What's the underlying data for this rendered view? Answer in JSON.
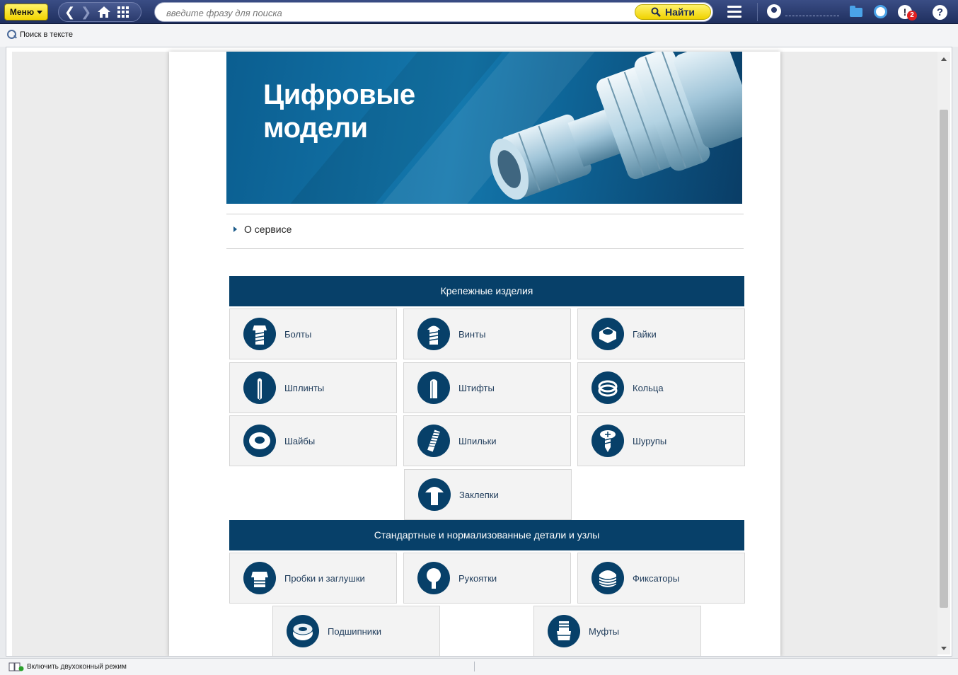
{
  "toolbar": {
    "menu_label": "Меню",
    "search_placeholder": "введите фразу для поиска",
    "find_label": "Найти",
    "notifications_count": "2",
    "help_label": "?",
    "alert_label": "!"
  },
  "subbar": {
    "search_in_text_label": "Поиск в тексте"
  },
  "banner": {
    "title_line1": "Цифровые",
    "title_line2": "модели"
  },
  "about": {
    "label": "О сервисе"
  },
  "sections": [
    {
      "title": "Крепежные изделия",
      "items": [
        {
          "label": "Болты",
          "icon": "bolt-icon"
        },
        {
          "label": "Винты",
          "icon": "screw-icon"
        },
        {
          "label": "Гайки",
          "icon": "nut-icon"
        },
        {
          "label": "Шплинты",
          "icon": "cotter-pin-icon"
        },
        {
          "label": "Штифты",
          "icon": "pin-icon"
        },
        {
          "label": "Кольца",
          "icon": "ring-icon"
        },
        {
          "label": "Шайбы",
          "icon": "washer-icon"
        },
        {
          "label": "Шпильки",
          "icon": "stud-icon"
        },
        {
          "label": "Шурупы",
          "icon": "wood-screw-icon"
        },
        {
          "label": "Заклепки",
          "icon": "rivet-icon"
        }
      ]
    },
    {
      "title": "Стандартные и нормализованные детали и узлы",
      "items": [
        {
          "label": "Пробки и заглушки",
          "icon": "plug-icon"
        },
        {
          "label": "Рукоятки",
          "icon": "handle-icon"
        },
        {
          "label": "Фиксаторы",
          "icon": "retainer-icon"
        },
        {
          "label": "Подшипники",
          "icon": "bearing-icon"
        },
        {
          "label": "Муфты",
          "icon": "coupling-icon"
        }
      ]
    }
  ],
  "statusbar": {
    "dual_window_label": "Включить двухоконный режим"
  },
  "colors": {
    "accent_dark_blue": "#074069",
    "yellow_button": "#f2d400",
    "toolbar_blue": "#2a3a6c"
  }
}
